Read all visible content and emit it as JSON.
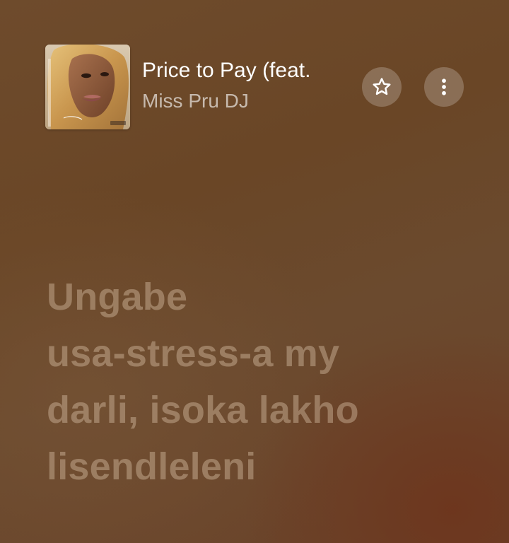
{
  "now_playing": {
    "title": "Price to Pay (feat.",
    "artist": "Miss Pru DJ",
    "artwork_icon": "album-artwork",
    "star_icon": "star-icon",
    "more_icon": "more-vertical-icon"
  },
  "lyrics": {
    "lines": [
      "Ungabe",
      "usa-stress-a my",
      "darli, isoka lakho",
      "lisendleleni"
    ]
  },
  "colors": {
    "background": "#6b4a2e",
    "title": "#ffffff",
    "artist": "#d2c2b2",
    "lyric": "#a88c72",
    "button": "#8e7560"
  }
}
